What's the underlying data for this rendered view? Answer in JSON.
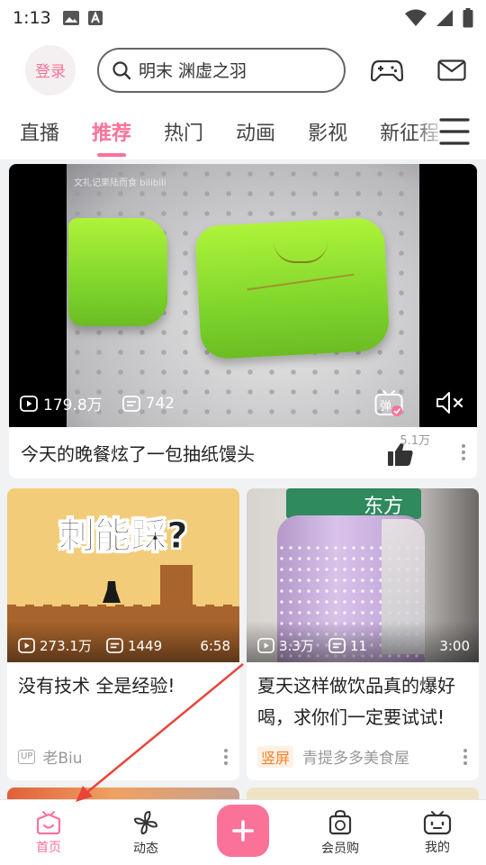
{
  "status_bar": {
    "time": "1:13"
  },
  "header": {
    "login_label": "登录",
    "search_placeholder": "明末 渊虚之羽",
    "icons": [
      "game-controller-icon",
      "mail-icon"
    ]
  },
  "tabs": [
    {
      "label": "直播",
      "active": false
    },
    {
      "label": "推荐",
      "active": true
    },
    {
      "label": "热门",
      "active": false
    },
    {
      "label": "动画",
      "active": false
    },
    {
      "label": "影视",
      "active": false
    },
    {
      "label": "新征程",
      "active": false
    }
  ],
  "featured": {
    "watermark": "文礼记果陆而食 bilibili",
    "views": "179.8万",
    "danmaku": "742",
    "danmaku_icon_label": "弹",
    "title": "今天的晚餐炫了一包抽纸馒头",
    "likes": "5.1万"
  },
  "cards": [
    {
      "thumb_text": "刺能踩?",
      "views": "273.1万",
      "danmaku": "1449",
      "duration": "6:58",
      "title": "没有技术 全是经验!",
      "badge": "UP",
      "author": "老Biu"
    },
    {
      "thumb_text": "东方",
      "views": "3.3万",
      "danmaku": "11",
      "duration": "3:00",
      "title": "夏天这样做饮品真的爆好喝，求你们一定要试试!",
      "badge": "竖屏",
      "author": "青提多多美食屋"
    }
  ],
  "bottom_nav": [
    {
      "label": "首页",
      "icon": "home-tv-icon",
      "active": true
    },
    {
      "label": "动态",
      "icon": "pinwheel-icon",
      "active": false
    },
    {
      "label": "",
      "icon": "plus-icon",
      "active": false
    },
    {
      "label": "会员购",
      "icon": "shopping-bag-icon",
      "active": false
    },
    {
      "label": "我的",
      "icon": "tv-face-icon",
      "active": false
    }
  ],
  "colors": {
    "accent": "#fb7299",
    "orange": "#ff7f24",
    "annotation_arrow": "#e8453c"
  }
}
